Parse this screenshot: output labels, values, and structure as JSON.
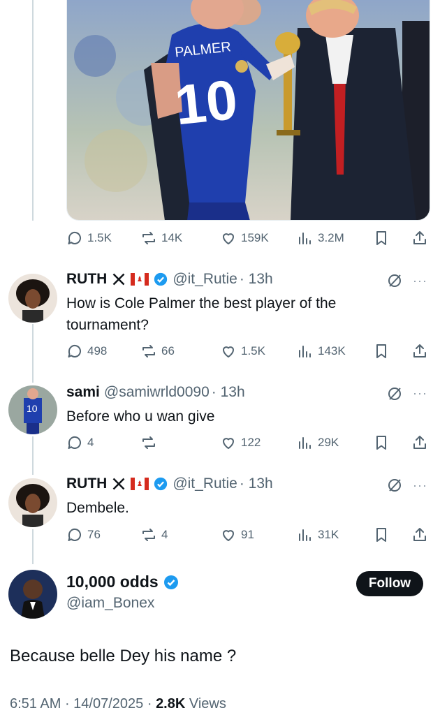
{
  "media": {
    "jersey_name": "PALMER",
    "jersey_number": "10"
  },
  "post_actions": {
    "replies": "1.5K",
    "reposts": "14K",
    "likes": "159K",
    "views": "3.2M"
  },
  "replies": [
    {
      "name": "RUTH",
      "handle": "@it_Rutie",
      "time": "· 13h",
      "text": "How is Cole Palmer the best player of the tournament?",
      "replies": "498",
      "reposts": "66",
      "likes": "1.5K",
      "views": "143K"
    },
    {
      "name": "sami",
      "handle": "@samiwrld0090",
      "time": "· 13h",
      "text": "Before who u wan give",
      "replies": "4",
      "reposts": "",
      "likes": "122",
      "views": "29K"
    },
    {
      "name": "RUTH",
      "handle": "@it_Rutie",
      "time": "· 13h",
      "text": "Dembele.",
      "replies": "76",
      "reposts": "4",
      "likes": "91",
      "views": "31K"
    }
  ],
  "main_post": {
    "name": "10,000 odds",
    "handle": "@iam_Bonex",
    "follow_label": "Follow",
    "text": "Because belle Dey his name ?",
    "time": "6:51 AM",
    "date": "14/07/2025",
    "views_count": "2.8K",
    "views_label": "Views"
  },
  "icons": [
    "reply-icon",
    "repost-icon",
    "like-icon",
    "views-icon",
    "bookmark-icon",
    "share-icon",
    "verified-icon",
    "x-logo-icon",
    "canada-flag-icon",
    "grok-icon",
    "more-icon"
  ],
  "colors": {
    "verified": "#1d9bf0",
    "text": "#0f1419",
    "muted": "#536471",
    "follow_bg": "#0f1419"
  }
}
